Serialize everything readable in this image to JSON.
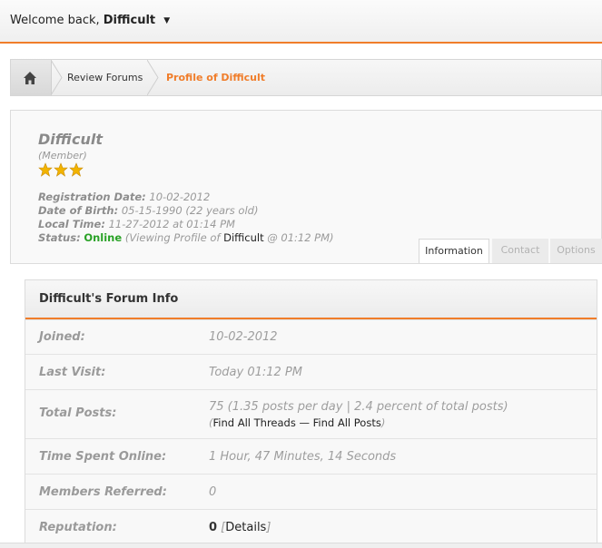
{
  "header": {
    "welcome_prefix": "Welcome back,",
    "username": "Difficult",
    "caret": "▼"
  },
  "breadcrumb": {
    "home_icon": "home-icon",
    "items": [
      {
        "label": "Review Forums"
      },
      {
        "label": "Profile of Difficult"
      }
    ]
  },
  "profile": {
    "name": "Difficult",
    "role": "(Member)",
    "stars": 3,
    "registration_label": "Registration Date:",
    "registration_value": "10-02-2012",
    "dob_label": "Date of Birth:",
    "dob_value": "05-15-1990 (22 years old)",
    "local_time_label": "Local Time:",
    "local_time_value": "11-27-2012 at 01:14 PM",
    "status_label": "Status:",
    "status_value": "Online",
    "status_detail_prefix": "(Viewing Profile of",
    "status_detail_user": "Difficult",
    "status_detail_suffix": "@ 01:12 PM)"
  },
  "tabs": [
    {
      "label": "Information",
      "active": true
    },
    {
      "label": "Contact",
      "active": false
    },
    {
      "label": "Options",
      "active": false
    }
  ],
  "forum_info": {
    "title": "Difficult's Forum Info",
    "joined_label": "Joined:",
    "joined_value": "10-02-2012",
    "last_visit_label": "Last Visit:",
    "last_visit_value": "Today 01:12 PM",
    "total_posts_label": "Total Posts:",
    "total_posts_value": "75 (1.35 posts per day | 2.4 percent of total posts)",
    "find_threads": "Find All Threads",
    "dash": "—",
    "find_posts": "Find All Posts",
    "time_online_label": "Time Spent Online:",
    "time_online_value": "1 Hour, 47 Minutes, 14 Seconds",
    "members_referred_label": "Members Referred:",
    "members_referred_value": "0",
    "reputation_label": "Reputation:",
    "reputation_value": "0",
    "details_link": "Details"
  },
  "colors": {
    "accent": "#f07d2a",
    "online": "#2aa227",
    "star": "#f2b400"
  }
}
